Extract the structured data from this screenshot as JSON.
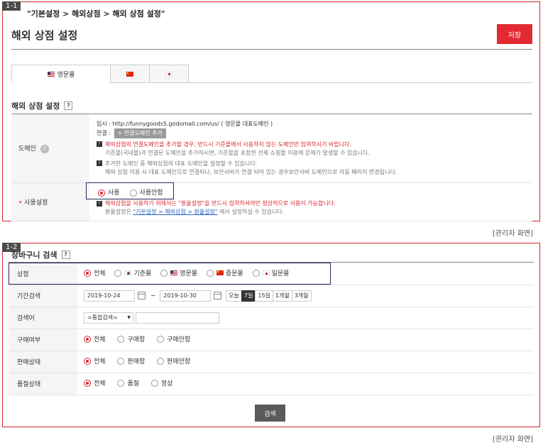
{
  "panel1": {
    "badge": "1-1",
    "breadcrumb": "\"기본설정 > 해외상점 > 해외 상점 설정\"",
    "title": "해외 상점 설정",
    "save_label": "저장",
    "tabs": [
      {
        "label": "영문몰",
        "flag": "us"
      },
      {
        "label": "",
        "flag": "cn"
      },
      {
        "label": "",
        "flag": "jp"
      }
    ],
    "section_title": "해외 상점 설정",
    "help": "?",
    "domain": {
      "label": "도메인",
      "temp_line": "임시 : http://funnygoods5.godomall.com/us/ ( 영문몰 대표도메인 )",
      "link_label": "연결 :",
      "link_button": "+ 연결도메인 추가",
      "notice1_red": "해외상점의 연결도메인을 추가할 경우, 반드시 기준몰에서 사용하지 않는 도메인만 입력하시기 바랍니다.",
      "notice1_grey": "기준몰(국내몰)과 연결된 도메인을 추가하시면, 기준몰을 포함한 전체 쇼핑몰 이용에 문제가 발생할 수 있습니다.",
      "notice2_line1": "추가한 도메인 중 해외상점의 대표 도메인을 설정할 수 있습니다.",
      "notice2_line2": "해외 상점 이용 시 대표 도메인으로 연결되나, 보안서버가 연결 되어 있는 경우보안서버 도메인으로 자동 페이지 변경됩니다."
    },
    "usage": {
      "label": "사용설정",
      "options": [
        "사용",
        "사용안함"
      ],
      "notice_red": "해외상점을 사용하기 위해서는 \"환율설정\"을 반드시 입력하셔야만 정상적으로 사용이 가능합니다.",
      "notice_prefix": "환율설정은 ",
      "notice_link": "\"기본설정 > 해외상점 > 환율설정\"",
      "notice_suffix": " 에서 설정하실 수 있습니다."
    }
  },
  "caption": "[관리자 화면]",
  "panel2": {
    "badge": "1-2",
    "title": "장바구니 검색",
    "rows": {
      "store": {
        "label": "상점",
        "options": [
          "전체",
          "기준몰",
          "영문몰",
          "중문몰",
          "일문몰"
        ]
      },
      "period": {
        "label": "기간검색",
        "start": "2019-10-24",
        "sep": "~",
        "end": "2019-10-30",
        "buttons": [
          "오늘",
          "7일",
          "15일",
          "1개월",
          "3개월"
        ]
      },
      "keyword": {
        "label": "검색어",
        "select": "=통합검색="
      },
      "purchase": {
        "label": "구매여부",
        "options": [
          "전체",
          "구매함",
          "구매안함"
        ]
      },
      "sale": {
        "label": "판매상태",
        "options": [
          "전체",
          "판매함",
          "판매안함"
        ]
      },
      "soldout": {
        "label": "품절상태",
        "options": [
          "전체",
          "품절",
          "정상"
        ]
      }
    },
    "search_label": "검색"
  },
  "colors": {
    "accent_red": "#d9232e",
    "highlight_navy": "#1e2b57",
    "save_button": "#e22a30"
  }
}
